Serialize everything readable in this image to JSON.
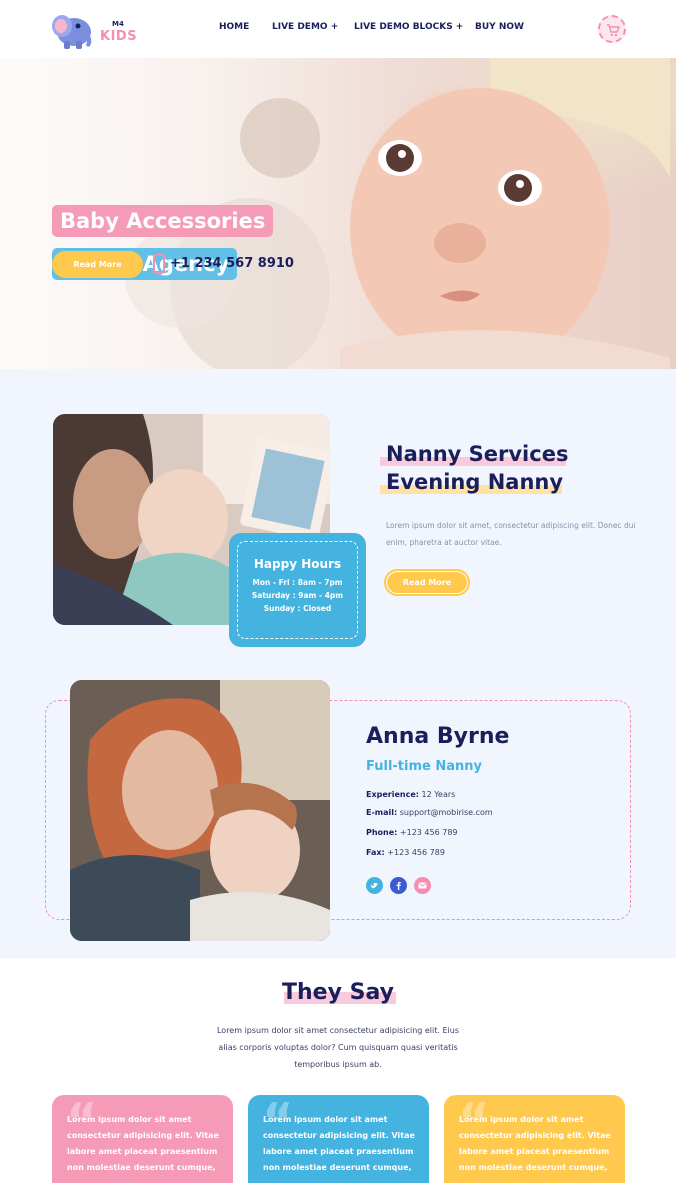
{
  "brand": {
    "top": "M4",
    "name": "KIDS"
  },
  "nav": {
    "items": [
      "HOME",
      "LIVE DEMO +",
      "LIVE DEMO BLOCKS +",
      "BUY NOW"
    ]
  },
  "hero": {
    "tag1": "Baby Accessories",
    "tag2": "Nanny Agency",
    "button": "Read More",
    "phone": "+1 234 567 8910"
  },
  "services": {
    "title1": "Nanny Services",
    "title2": "Evening Nanny",
    "text": "Lorem ipsum dolor sit amet, consectetur adipiscing elit. Donec dui enim, pharetra at auctor vitae.",
    "button": "Read More",
    "hours": {
      "title": "Happy Hours",
      "lines": [
        "Mon - Fri : 8am - 7pm",
        "Saturday : 9am - 4pm",
        "Sunday : Closed"
      ]
    }
  },
  "profile": {
    "name": "Anna Byrne",
    "role": "Full-time Nanny",
    "rows": [
      {
        "label": "Experience:",
        "value": " 12 Years"
      },
      {
        "label": "E-mail:",
        "value": " support@mobirise.com"
      },
      {
        "label": "Phone:",
        "value": " +123 456 789"
      },
      {
        "label": "Fax:",
        "value": " +123 456 789"
      }
    ],
    "social_icons": [
      "twitter-icon",
      "facebook-icon",
      "email-icon"
    ]
  },
  "testimonials": {
    "title": "They Say",
    "intro": "Lorem ipsum dolor sit amet consectetur adipisicing elit. Eius alias corporis voluptas dolor? Cum quisquam quasi veritatis temporibus ipsum ab.",
    "cards": [
      {
        "text": "Lorem ipsum dolor sit amet consectetur adipisicing elit. Vitae labore amet placeat praesentium non molestiae deserunt cumque,",
        "color": "#f59ab7"
      },
      {
        "text": "Lorem ipsum dolor sit amet consectetur adipisicing elit. Vitae labore amet placeat praesentium non molestiae deserunt cumque,",
        "color": "#45b3e0"
      },
      {
        "text": "Lorem ipsum dolor sit amet consectetur adipisicing elit. Vitae labore amet placeat praesentium non molestiae deserunt cumque,",
        "color": "#ffc94d"
      }
    ]
  },
  "colors": {
    "navy": "#1a1f5c",
    "pink": "#f59ab7",
    "blue": "#45b3e0",
    "yellow": "#ffc94d"
  }
}
